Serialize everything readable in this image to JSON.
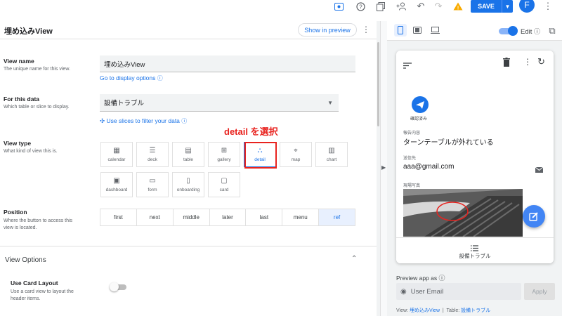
{
  "toolbar": {
    "save_label": "SAVE",
    "avatar_initial": "F",
    "icons": [
      "preview-icon",
      "help-icon",
      "copy-icon",
      "add-person-icon",
      "undo-icon",
      "redo-icon",
      "warning-icon"
    ]
  },
  "header": {
    "title": "埋め込みView",
    "show_preview": "Show in preview"
  },
  "form": {
    "view_name": {
      "label": "View name",
      "desc": "The unique name for this view.",
      "value": "埋め込みView",
      "link": "Go to display options"
    },
    "for_this_data": {
      "label": "For this data",
      "desc": "Which table or slice to display.",
      "value": "設備トラブル",
      "link": "Use slices to filter your data"
    },
    "view_type": {
      "label": "View type",
      "desc": "What kind of view this is.",
      "types": [
        {
          "label": "calendar",
          "icon": "calendar-icon",
          "glyph": "▦"
        },
        {
          "label": "deck",
          "icon": "deck-icon",
          "glyph": "☰"
        },
        {
          "label": "table",
          "icon": "table-icon",
          "glyph": "▤"
        },
        {
          "label": "gallery",
          "icon": "gallery-icon",
          "glyph": "⊞"
        },
        {
          "label": "detail",
          "icon": "detail-icon",
          "glyph": "⛬"
        },
        {
          "label": "map",
          "icon": "map-icon",
          "glyph": "⌖"
        },
        {
          "label": "chart",
          "icon": "chart-icon",
          "glyph": "▥"
        },
        {
          "label": "dashboard",
          "icon": "dashboard-icon",
          "glyph": "▣"
        },
        {
          "label": "form",
          "icon": "form-icon",
          "glyph": "▭"
        },
        {
          "label": "onboarding",
          "icon": "onboarding-icon",
          "glyph": "▯"
        },
        {
          "label": "card",
          "icon": "card-icon",
          "glyph": "▢"
        }
      ],
      "selected": "detail",
      "annotation": "detail を選択"
    },
    "position": {
      "label": "Position",
      "desc1": "Where the button to access this",
      "desc2": "view is located.",
      "options": [
        "first",
        "next",
        "middle",
        "later",
        "last",
        "menu",
        "ref"
      ],
      "selected": "ref"
    },
    "view_options": {
      "title": "View Options",
      "card_layout_label": "Use Card Layout",
      "card_layout_desc1": "Use a card view to layout the",
      "card_layout_desc2": "header items.",
      "card_layout_on": false
    }
  },
  "preview": {
    "edit_label": "Edit",
    "edit_on": true,
    "action_label": "確認済み",
    "fields": [
      {
        "label": "報告内容",
        "value": "ターンテーブルが外れている"
      },
      {
        "label": "送信先",
        "value": "aaa@gmail.com"
      },
      {
        "label": "現場写真",
        "value": ""
      }
    ],
    "bottom_nav_label": "設備トラブル",
    "preview_as_label": "Preview app as",
    "email_placeholder": "User Email",
    "apply_label": "Apply",
    "footer_view_prefix": "View:",
    "footer_view": "埋め込みView",
    "footer_sep": "|",
    "footer_table_prefix": "Table:",
    "footer_table": "設備トラブル"
  },
  "colors": {
    "accent": "#1a73e8",
    "annotation": "#e8231f"
  }
}
